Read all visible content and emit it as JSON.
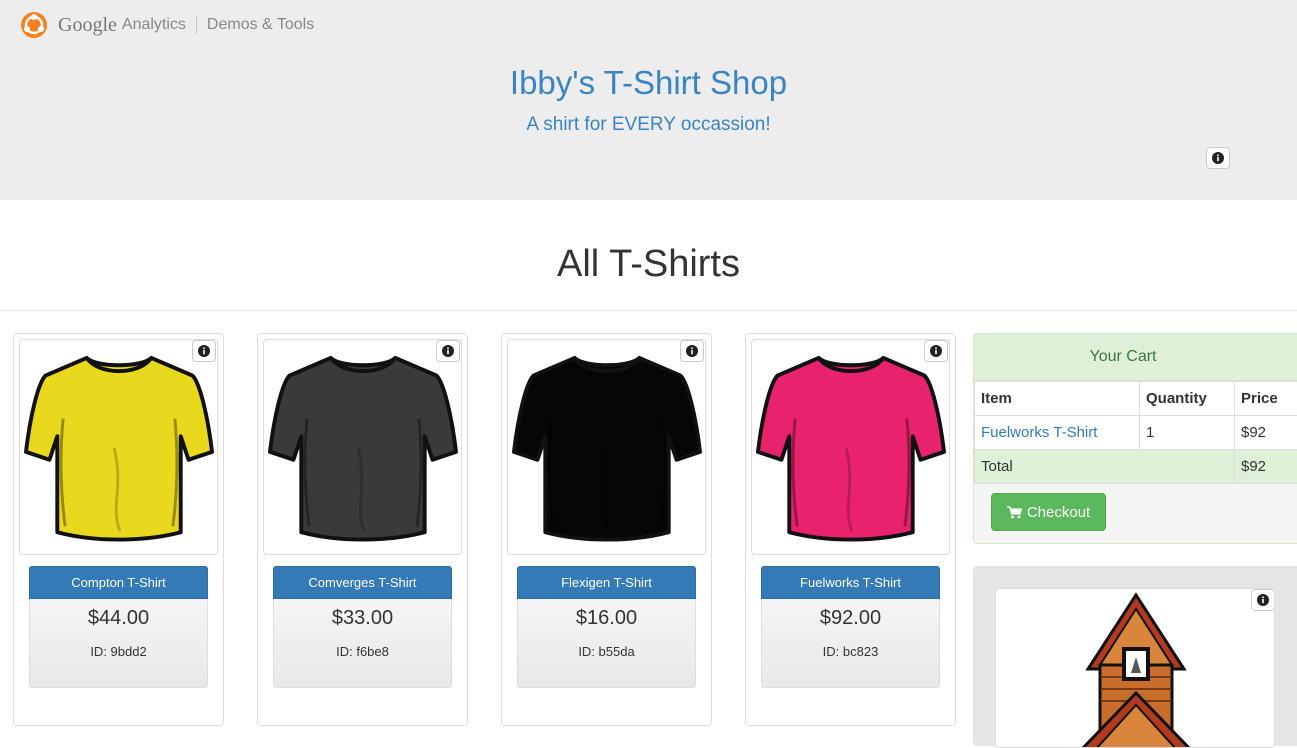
{
  "header": {
    "brand_google": "Google",
    "brand_analytics": "Analytics",
    "brand_demos": "Demos & Tools",
    "logo_icon": "google-analytics-logo-icon",
    "shop_title": "Ibby's T-Shirt Shop",
    "shop_subtitle": "A shirt for EVERY occassion!",
    "info_icon": "info-icon"
  },
  "main": {
    "section_title": "All T-Shirts"
  },
  "products": [
    {
      "name": "Compton T-Shirt",
      "price": "$44.00",
      "id": "ID: 9bdd2",
      "color": "#e8d81e"
    },
    {
      "name": "Comverges T-Shirt",
      "price": "$33.00",
      "id": "ID: f6be8",
      "color": "#3a3a3a"
    },
    {
      "name": "Flexigen T-Shirt",
      "price": "$16.00",
      "id": "ID: b55da",
      "color": "#060606"
    },
    {
      "name": "Fuelworks T-Shirt",
      "price": "$92.00",
      "id": "ID: bc823",
      "color": "#e8226c"
    }
  ],
  "cart": {
    "title": "Your Cart",
    "columns": [
      "Item",
      "Quantity",
      "Price"
    ],
    "rows": [
      {
        "item": "Fuelworks T-Shirt",
        "quantity": "1",
        "price": "$92"
      }
    ],
    "total_label": "Total",
    "total_value": "$92",
    "checkout_label": "Checkout",
    "checkout_icon": "shopping-cart-icon"
  },
  "colors": {
    "accent_blue": "#337ab7",
    "title_blue": "#3a84c3",
    "success_green": "#5cb85c",
    "cart_header_bg": "#dff0d8"
  }
}
